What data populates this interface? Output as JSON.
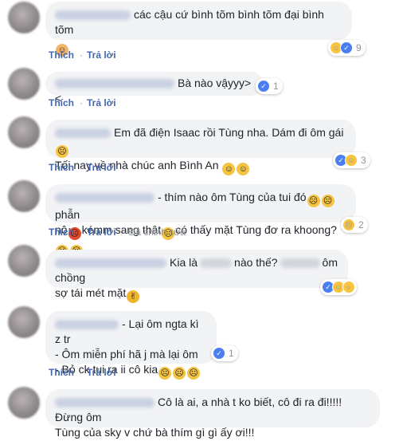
{
  "actions": {
    "like": "Thích",
    "reply": "Trả lời",
    "edited": "Đã chỉnh sửa"
  },
  "comments": [
    {
      "text": "các cậu cứ bình tõm bình tõm đại bình tõm",
      "emoji": [
        "woman-shrug"
      ],
      "reactions": [
        "haha",
        "like"
      ],
      "count": "9"
    },
    {
      "text": "Bà nào vậyyy><",
      "reactions": [
        "like"
      ],
      "count": "1"
    },
    {
      "line1": "Em đã điện Isaac rồi Tùng nha. Dám đi ôm gái",
      "line2": "Tối nay về nhà chúc anh Bình An",
      "reactions": [
        "like",
        "haha"
      ],
      "count": "3"
    },
    {
      "line1a": "- thím nào ôm Tùng của tui đó",
      "line1b": "phẫn",
      "line2a": "nộ",
      "line2b": "kémm sang thật",
      "line2c": "có thấy mặt Tùng đơ ra khoong?",
      "reactions": [
        "sad"
      ],
      "count": "2"
    },
    {
      "line1a": "Kia là",
      "line1b": "nào thế?",
      "line1c": "ôm chồng",
      "line2": "sợ tái mét mặt",
      "reactions": [
        "like",
        "haha",
        "wow"
      ]
    },
    {
      "line1": "- Lại ôm ngta kì z tr",
      "line2": "- Ôm miễn phí hã j mà lại ôm",
      "line3": "- Bỏ ck tui ra ii cô kia",
      "reactions": [
        "like"
      ],
      "count": "1"
    },
    {
      "line1": "Cô là ai, a nhà t ko biết, cô đi ra đi!!!!! Đừng ôm",
      "line2": "Tùng của sky v chứ bà thím gì gì ấy ơi!!!"
    }
  ]
}
